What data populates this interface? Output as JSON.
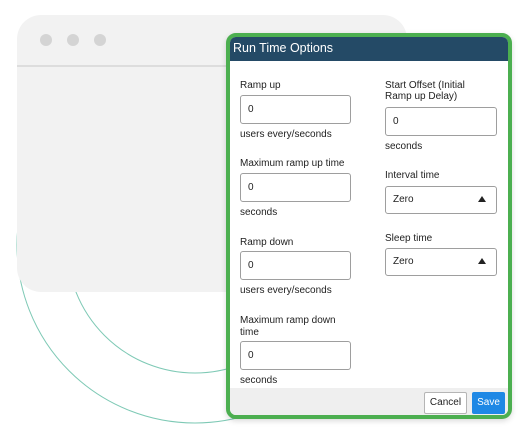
{
  "dialog": {
    "title": "Run Time Options",
    "ramp_up": {
      "label": "Ramp up",
      "value": "0",
      "unit": "users every/seconds"
    },
    "max_ramp_up_time": {
      "label": "Maximum ramp up time",
      "value": "0",
      "unit": "seconds"
    },
    "ramp_down": {
      "label": "Ramp down",
      "value": "0",
      "unit": "users every/seconds"
    },
    "max_ramp_down_time": {
      "label_line1": "Maximum ramp down",
      "label_line2": "time",
      "value": "0",
      "unit": "seconds"
    },
    "start_offset": {
      "label_line1": "Start Offset (Initial",
      "label_line2": "Ramp up Delay)",
      "value": "0",
      "unit": "seconds"
    },
    "interval_time": {
      "label": "Interval time",
      "selected": "Zero"
    },
    "sleep_time": {
      "label": "Sleep time",
      "selected": "Zero"
    },
    "footer": {
      "cancel_label": "Cancel",
      "save_label": "Save"
    }
  },
  "colors": {
    "header_bg": "#244a66",
    "highlight_border": "#4caf50",
    "save_button": "#1e88e5",
    "background_arcs": "#7ec9b5"
  }
}
